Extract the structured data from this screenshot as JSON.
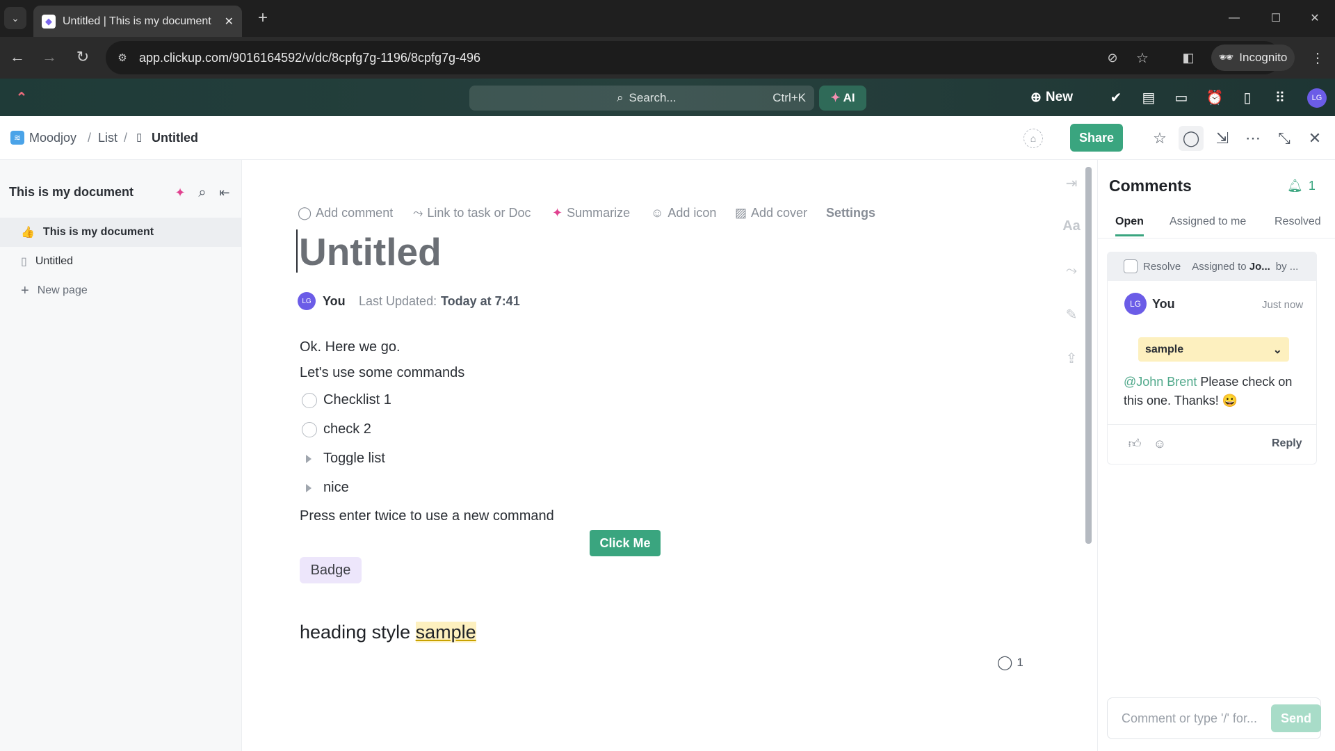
{
  "browser": {
    "tab_title": "Untitled | This is my document",
    "url": "app.clickup.com/9016164592/v/dc/8cpfg7g-1196/8cpfg7g-496",
    "incognito_label": "Incognito"
  },
  "app_header": {
    "search_placeholder": "Search...",
    "search_shortcut": "Ctrl+K",
    "ai_label": "AI",
    "new_label": "New",
    "avatar": "LG"
  },
  "breadcrumb": {
    "items": [
      "Moodjoy",
      "List",
      "Untitled"
    ]
  },
  "toolbar": {
    "share_label": "Share"
  },
  "sidebar": {
    "title": "This is my document",
    "items": [
      {
        "label": "This is my document",
        "icon": "thumbs-up-emoji"
      },
      {
        "label": "Untitled",
        "icon": "doc-icon"
      },
      {
        "label": "New page",
        "icon": "plus-icon"
      }
    ]
  },
  "editor": {
    "actions": [
      "Add comment",
      "Link to task or Doc",
      "Summarize",
      "Add icon",
      "Add cover",
      "Settings"
    ],
    "title": "Untitled",
    "author_avatar": "LG",
    "author": "You",
    "last_updated_label": "Last Updated:",
    "last_updated_value": "Today at 7:41",
    "paragraphs": [
      "Ok. Here we go.",
      "Let's use some commands"
    ],
    "checklist": [
      "Checklist 1",
      "check 2"
    ],
    "toggles": [
      "Toggle list",
      "nice"
    ],
    "hint": "Press enter twice to use a new command",
    "button_label": "Click Me",
    "badge_label": "Badge",
    "heading_text": "heading style ",
    "heading_highlight": "sample",
    "comment_count": "1"
  },
  "comments": {
    "title": "Comments",
    "notification_count": "1",
    "tabs": [
      "Open",
      "Assigned to me",
      "Resolved"
    ],
    "active_tab": "Open",
    "thread": {
      "resolve_label": "Resolve",
      "assigned_prefix": "Assigned to ",
      "assigned_name": "Jo...",
      "by_label": "by ...",
      "avatar": "LG",
      "author": "You",
      "time": "Just now",
      "quoted": "sample",
      "mention": "@John Brent",
      "body": " Please check on this one. Thanks! 😀",
      "reply_label": "Reply"
    },
    "input_placeholder": "Comment or type '/' for...",
    "send_label": "Send"
  },
  "colors": {
    "accent": "#3aa57f",
    "avatar": "#6b5ce7",
    "highlight": "#fdf0bf",
    "badge": "#ede6fb",
    "mention": "#4fa88a"
  }
}
